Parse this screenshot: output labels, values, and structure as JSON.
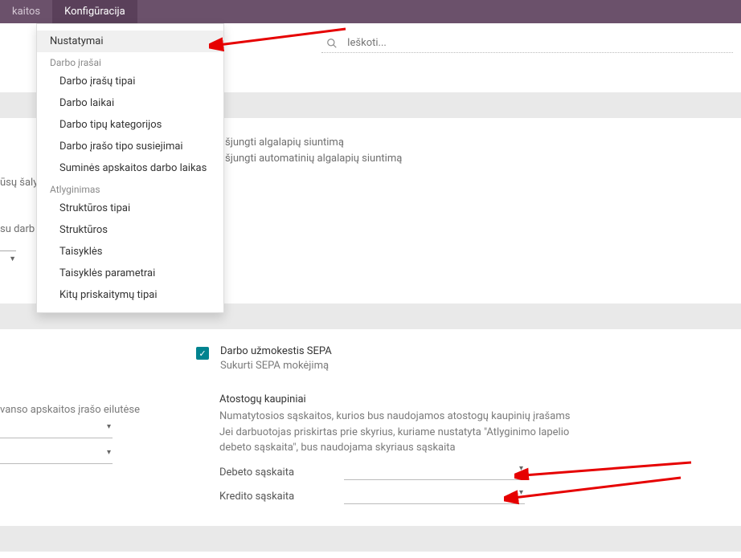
{
  "topbar": {
    "tabs": [
      {
        "label": "kaitos"
      },
      {
        "label": "Konfigūracija"
      }
    ]
  },
  "menu": {
    "item_settings": "Nustatymai",
    "group_work": "Darbo įrašai",
    "items_work": [
      "Darbo įrašų tipai",
      "Darbo laikai",
      "Darbo tipų kategorijos",
      "Darbo įrašo tipo susiejimai",
      "Suminės apskaitos darbo laikas"
    ],
    "group_salary": "Atlyginimas",
    "items_salary": [
      "Struktūros tipai",
      "Struktūros",
      "Taisyklės",
      "Taisyklės parametrai",
      "Kitų priskaitymų tipai"
    ]
  },
  "search": {
    "placeholder": "Ieškoti..."
  },
  "payslip": {
    "line1": "šjungti algalapių siuntimą",
    "line2": "šjungti automatinių algalapių siuntimą"
  },
  "left": {
    "text1": "ūsų šaly",
    "text2": "su darb"
  },
  "sepa": {
    "label": "Darbo užmokestis SEPA",
    "sub": "Sukurti SEPA mokėjimą"
  },
  "holiday": {
    "title": "Atostogų kaupiniai",
    "desc1": "Numatytosios sąskaitos, kurios bus naudojamos atostogų kaupinių įrašams",
    "desc2": "Jei darbuotojas priskirtas prie skyrius, kuriame nustatyta \"Atlyginimo lapelio debeto sąskaita\", bus naudojama skyriaus sąskaita",
    "debit": "Debeto sąskaita",
    "credit": "Kredito sąskaita"
  },
  "left_block": {
    "title": "vanso apskaitos įrašo eilutėse"
  }
}
